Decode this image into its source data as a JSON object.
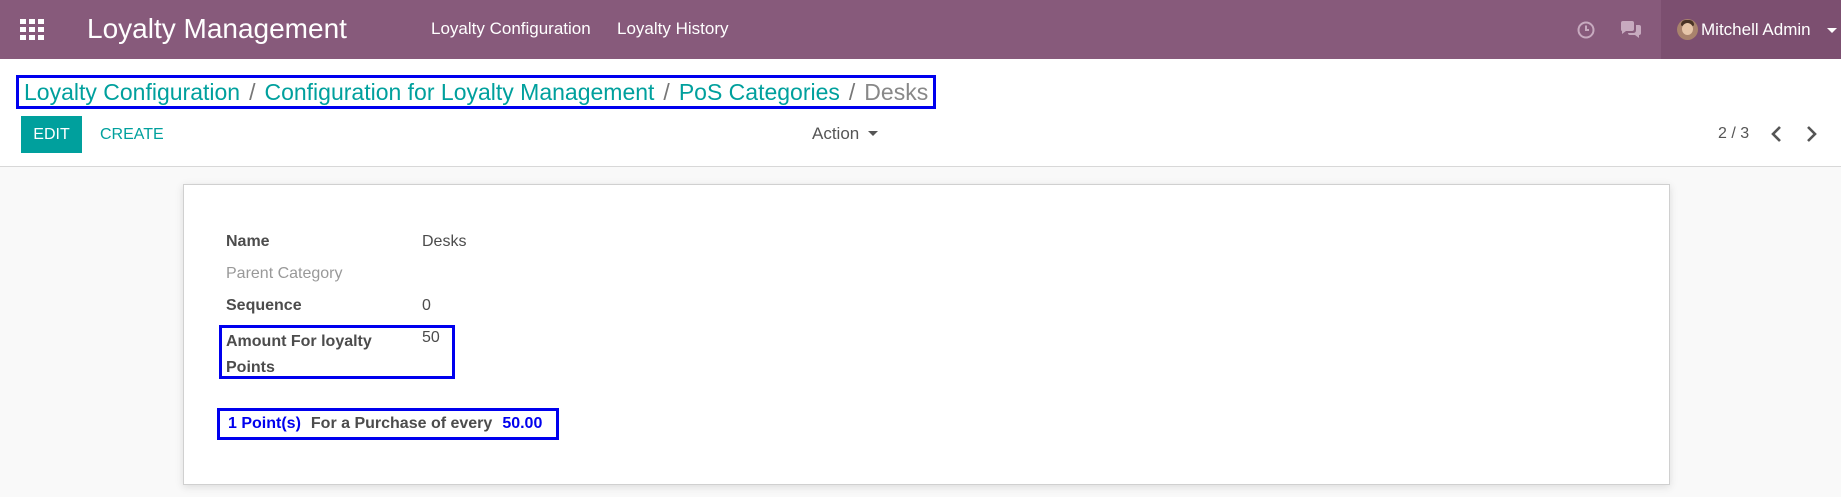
{
  "navbar": {
    "apps_icon": "apps-grid-icon",
    "app_title": "Loyalty Management",
    "menus": [
      "Loyalty Configuration",
      "Loyalty History"
    ],
    "activity_icon": "clock-icon",
    "messaging_icon": "chat-icon",
    "user_name": "Mitchell Admin",
    "background_color": "#875a7b"
  },
  "breadcrumb": {
    "items": [
      "Loyalty Configuration",
      "Configuration for Loyalty Management",
      "PoS Categories"
    ],
    "separator": "/",
    "current": "Desks"
  },
  "toolbar": {
    "edit_label": "EDIT",
    "create_label": "CREATE",
    "action_label": "Action",
    "accent_color": "#00a09d"
  },
  "pager": {
    "value": "2 / 3"
  },
  "form": {
    "fields": [
      {
        "label": "Name",
        "value": "Desks"
      },
      {
        "label": "Parent Category",
        "value": ""
      },
      {
        "label": "Sequence",
        "value": "0"
      },
      {
        "label": "Amount For loyalty Points",
        "value": "50"
      }
    ],
    "points_line": {
      "points": "1 Point(s)",
      "text": "For a Purchase of every",
      "amount": "50.00"
    }
  }
}
